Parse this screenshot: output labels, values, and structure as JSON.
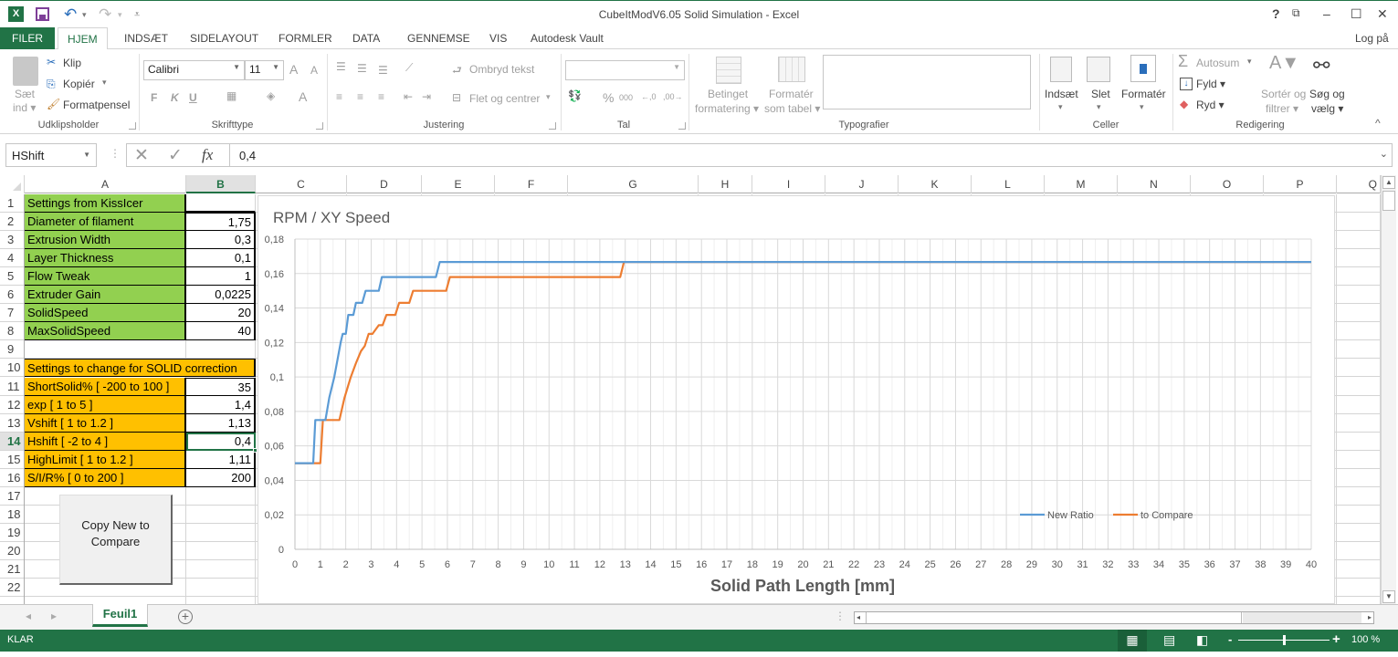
{
  "window": {
    "title": "CubeItModV6.05 Solid Simulation - Excel",
    "help": "?",
    "ribbon_display": "⧉",
    "minimize": "–",
    "maximize": "☐",
    "close": "✕",
    "sign_in": "Log på"
  },
  "qat": {
    "app_icon": "X",
    "undo": "↶",
    "undo_dd": "▾",
    "redo": "↷",
    "redo_dd": "▾",
    "customize": "⩡"
  },
  "tabs": [
    {
      "label": "FILER"
    },
    {
      "label": "HJEM"
    },
    {
      "label": "INDSÆT"
    },
    {
      "label": "SIDELAYOUT"
    },
    {
      "label": "FORMLER"
    },
    {
      "label": "DATA"
    },
    {
      "label": "GENNEMSE"
    },
    {
      "label": "VIS"
    },
    {
      "label": "Autodesk Vault"
    }
  ],
  "ribbon": {
    "clipboard": {
      "label": "Udklipsholder",
      "paste_line1": "Sæt",
      "paste_line2": "ind ▾",
      "cut": "Klip",
      "copy": "Kopiér",
      "copy_dd": "▾",
      "format_painter": "Formatpensel"
    },
    "font": {
      "label": "Skrifttype",
      "font_name": "Calibri",
      "font_size": "11",
      "grow": "A",
      "shrink": "A",
      "bold": "F",
      "italic": "K",
      "underline": "U",
      "font_color": "A"
    },
    "alignment": {
      "label": "Justering",
      "wrap_text": "Ombryd tekst",
      "merge_center": "Flet og centrer",
      "merge_dd": "▾"
    },
    "number": {
      "label": "Tal",
      "format_value": "",
      "percent": "%",
      "thousands": "000",
      "inc_decimal": "←,0",
      "dec_decimal": ",00→"
    },
    "styles": {
      "label": "Typografier",
      "conditional_1": "Betinget",
      "conditional_2": "formatering ▾",
      "format_table_1": "Formatér",
      "format_table_2": "som tabel ▾"
    },
    "cells": {
      "label": "Celler",
      "insert": "Indsæt",
      "delete": "Slet",
      "format": "Formatér",
      "dd": "▾"
    },
    "editing": {
      "label": "Redigering",
      "autosum": "Autosum",
      "autosum_dd": "▾",
      "fill": "Fyld ▾",
      "clear": "Ryd ▾",
      "sort_1": "Sortér og",
      "sort_2": "filtrer ▾",
      "find_1": "Søg og",
      "find_2": "vælg ▾",
      "collapse": "^"
    }
  },
  "formula_bar": {
    "name_box": "HShift",
    "cancel": "✕",
    "enter": "✓",
    "fx": "fx",
    "value": "0,4"
  },
  "columns": [
    "A",
    "B",
    "C",
    "D",
    "E",
    "F",
    "G",
    "H",
    "I",
    "J",
    "K",
    "L",
    "M",
    "N",
    "O",
    "P",
    "Q"
  ],
  "rows": [
    "1",
    "2",
    "3",
    "4",
    "5",
    "6",
    "7",
    "8",
    "9",
    "10",
    "11",
    "12",
    "13",
    "14",
    "15",
    "16",
    "17",
    "18",
    "19",
    "20",
    "21",
    "22"
  ],
  "cells": [
    {
      "row": 1,
      "a": "Settings from KissIcer",
      "b": "",
      "style": "green"
    },
    {
      "row": 2,
      "a": "Diameter of filament",
      "b": "1,75",
      "style": "green"
    },
    {
      "row": 3,
      "a": "Extrusion Width",
      "b": "0,3",
      "style": "green"
    },
    {
      "row": 4,
      "a": "Layer Thickness",
      "b": "0,1",
      "style": "green"
    },
    {
      "row": 5,
      "a": "Flow Tweak",
      "b": "1",
      "style": "green"
    },
    {
      "row": 6,
      "a": "Extruder Gain",
      "b": "0,0225",
      "style": "green"
    },
    {
      "row": 7,
      "a": "SolidSpeed",
      "b": "20",
      "style": "green"
    },
    {
      "row": 8,
      "a": "MaxSolidSpeed",
      "b": "40",
      "style": "green"
    },
    {
      "row": 10,
      "a": "Settings to change for SOLID correction",
      "b": "",
      "style": "orange-merged"
    },
    {
      "row": 11,
      "a": "ShortSolid% [ -200 to 100 ]",
      "b": "35",
      "style": "orange"
    },
    {
      "row": 12,
      "a": "exp [ 1 to 5 ]",
      "b": "1,4",
      "style": "orange"
    },
    {
      "row": 13,
      "a": "Vshift [ 1 to 1.2 ]",
      "b": "1,13",
      "style": "orange"
    },
    {
      "row": 14,
      "a": "Hshift [ -2 to 4 ]",
      "b": "0,4",
      "style": "orange"
    },
    {
      "row": 15,
      "a": "HighLimit [ 1 to 1.2 ]",
      "b": "1,11",
      "style": "orange"
    },
    {
      "row": 16,
      "a": "S/I/R% [ 0 to 200 ]",
      "b": "200",
      "style": "orange"
    }
  ],
  "selected_cell": "B14",
  "macro_button": {
    "label_line1": "Copy New to",
    "label_line2": "Compare"
  },
  "chart_data": {
    "type": "line",
    "title": "RPM / XY Speed",
    "xlabel": "Solid Path Length [mm]",
    "ylabel": "",
    "xlim": [
      0,
      40
    ],
    "ylim": [
      0,
      0.18
    ],
    "x_ticks": [
      0,
      1,
      2,
      3,
      4,
      5,
      6,
      7,
      8,
      9,
      10,
      11,
      12,
      13,
      14,
      15,
      16,
      17,
      18,
      19,
      20,
      21,
      22,
      23,
      24,
      25,
      26,
      27,
      28,
      29,
      30,
      31,
      32,
      33,
      34,
      35,
      36,
      37,
      38,
      39,
      40
    ],
    "y_ticks": [
      "0",
      "0,02",
      "0,04",
      "0,06",
      "0,08",
      "0,1",
      "0,12",
      "0,14",
      "0,16",
      "0,18"
    ],
    "y_tick_values": [
      0,
      0.02,
      0.04,
      0.06,
      0.08,
      0.1,
      0.12,
      0.14,
      0.16,
      0.18
    ],
    "grid": true,
    "legend_position": "bottom-right",
    "series": [
      {
        "name": "New Ratio",
        "color": "#5b9bd5",
        "x": [
          0,
          0.72,
          0.8,
          1.2,
          1.35,
          1.55,
          1.7,
          1.8,
          1.88,
          2.0,
          2.1,
          2.2,
          2.3,
          2.4,
          2.5,
          2.65,
          2.78,
          2.9,
          3.3,
          3.42,
          3.55,
          5.55,
          5.7,
          40
        ],
        "y": [
          0.05,
          0.05,
          0.075,
          0.075,
          0.088,
          0.1,
          0.112,
          0.12,
          0.125,
          0.125,
          0.136,
          0.136,
          0.136,
          0.143,
          0.143,
          0.143,
          0.15,
          0.15,
          0.15,
          0.158,
          0.158,
          0.158,
          0.1667,
          0.1667
        ]
      },
      {
        "name": "to Compare",
        "color": "#ed7d31",
        "x": [
          0,
          1.0,
          1.1,
          1.75,
          1.95,
          2.2,
          2.4,
          2.6,
          2.75,
          2.9,
          3.05,
          3.3,
          3.45,
          3.6,
          3.95,
          4.1,
          4.5,
          4.65,
          5.95,
          6.1,
          12.8,
          12.95,
          40
        ],
        "y": [
          0.05,
          0.05,
          0.075,
          0.075,
          0.088,
          0.1,
          0.108,
          0.115,
          0.118,
          0.125,
          0.125,
          0.13,
          0.13,
          0.136,
          0.136,
          0.143,
          0.143,
          0.15,
          0.15,
          0.158,
          0.158,
          0.1667,
          0.1667
        ]
      }
    ]
  },
  "sheet_tabs": [
    {
      "label": "Feuil1",
      "active": true
    }
  ],
  "sheet_nav": {
    "prev": "◂",
    "next": "▸",
    "add": "+"
  },
  "status": {
    "mode": "KLAR",
    "zoom_minus": "-",
    "zoom_plus": "+",
    "zoom_level": "100 %",
    "zoom_fraction": 0.5
  },
  "colors": {
    "excel_green": "#217346",
    "kisslicer_fill": "#92d050",
    "solid_fill": "#ffc000"
  }
}
